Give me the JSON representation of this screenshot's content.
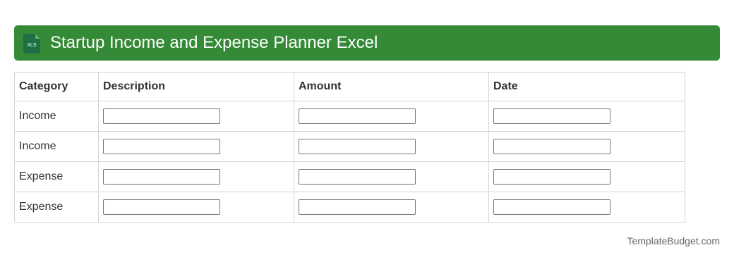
{
  "header": {
    "title": "Startup Income and Expense Planner Excel",
    "icon": "xls-file-icon",
    "icon_text": "XLS",
    "bg_color": "#348a36"
  },
  "table": {
    "columns": [
      "Category",
      "Description",
      "Amount",
      "Date"
    ],
    "rows": [
      {
        "category": "Income",
        "description": "",
        "amount": "",
        "date": ""
      },
      {
        "category": "Income",
        "description": "",
        "amount": "",
        "date": ""
      },
      {
        "category": "Expense",
        "description": "",
        "amount": "",
        "date": ""
      },
      {
        "category": "Expense",
        "description": "",
        "amount": "",
        "date": ""
      }
    ]
  },
  "footer": {
    "text": "TemplateBudget.com"
  }
}
